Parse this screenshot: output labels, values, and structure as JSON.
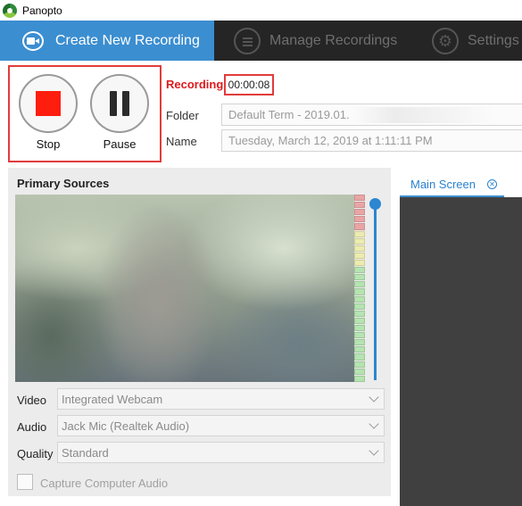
{
  "app": {
    "title": "Panopto"
  },
  "nav": {
    "tabs": [
      {
        "label": "Create New Recording",
        "icon": "camera-icon",
        "active": true
      },
      {
        "label": "Manage Recordings",
        "icon": "list-icon",
        "active": false
      },
      {
        "label": "Settings",
        "icon": "gear-icon",
        "active": false
      }
    ]
  },
  "controls": {
    "stop_label": "Stop",
    "pause_label": "Pause",
    "status": "Recording",
    "elapsed": "00:00:08"
  },
  "fields": {
    "folder_label": "Folder",
    "folder_value": "Default Term - 2019.01.",
    "name_label": "Name",
    "name_value": "Tuesday, March 12, 2019 at 1:11:11 PM"
  },
  "sources": {
    "title": "Primary Sources",
    "video_label": "Video",
    "video_value": "Integrated Webcam",
    "audio_label": "Audio",
    "audio_value": "Jack Mic (Realtek Audio)",
    "quality_label": "Quality",
    "quality_value": "Standard",
    "capture_audio_label": "Capture Computer Audio",
    "capture_audio_checked": false
  },
  "screen": {
    "tab_label": "Main Screen"
  },
  "colors": {
    "accent": "#3b8ed0",
    "recording": "#e0181c",
    "stop": "#ff1d0d",
    "highlight_box": "#e23b3b",
    "meter": {
      "red": "#e9a5a5",
      "yellow": "#ecebb0",
      "green": "#b5e3b1"
    }
  },
  "meter_levels": [
    "red",
    "red",
    "red",
    "red",
    "red",
    "yellow",
    "yellow",
    "yellow",
    "yellow",
    "yellow",
    "green",
    "green",
    "green",
    "green",
    "green",
    "green",
    "green",
    "green",
    "green",
    "green",
    "green",
    "green",
    "green",
    "green",
    "green",
    "green"
  ]
}
